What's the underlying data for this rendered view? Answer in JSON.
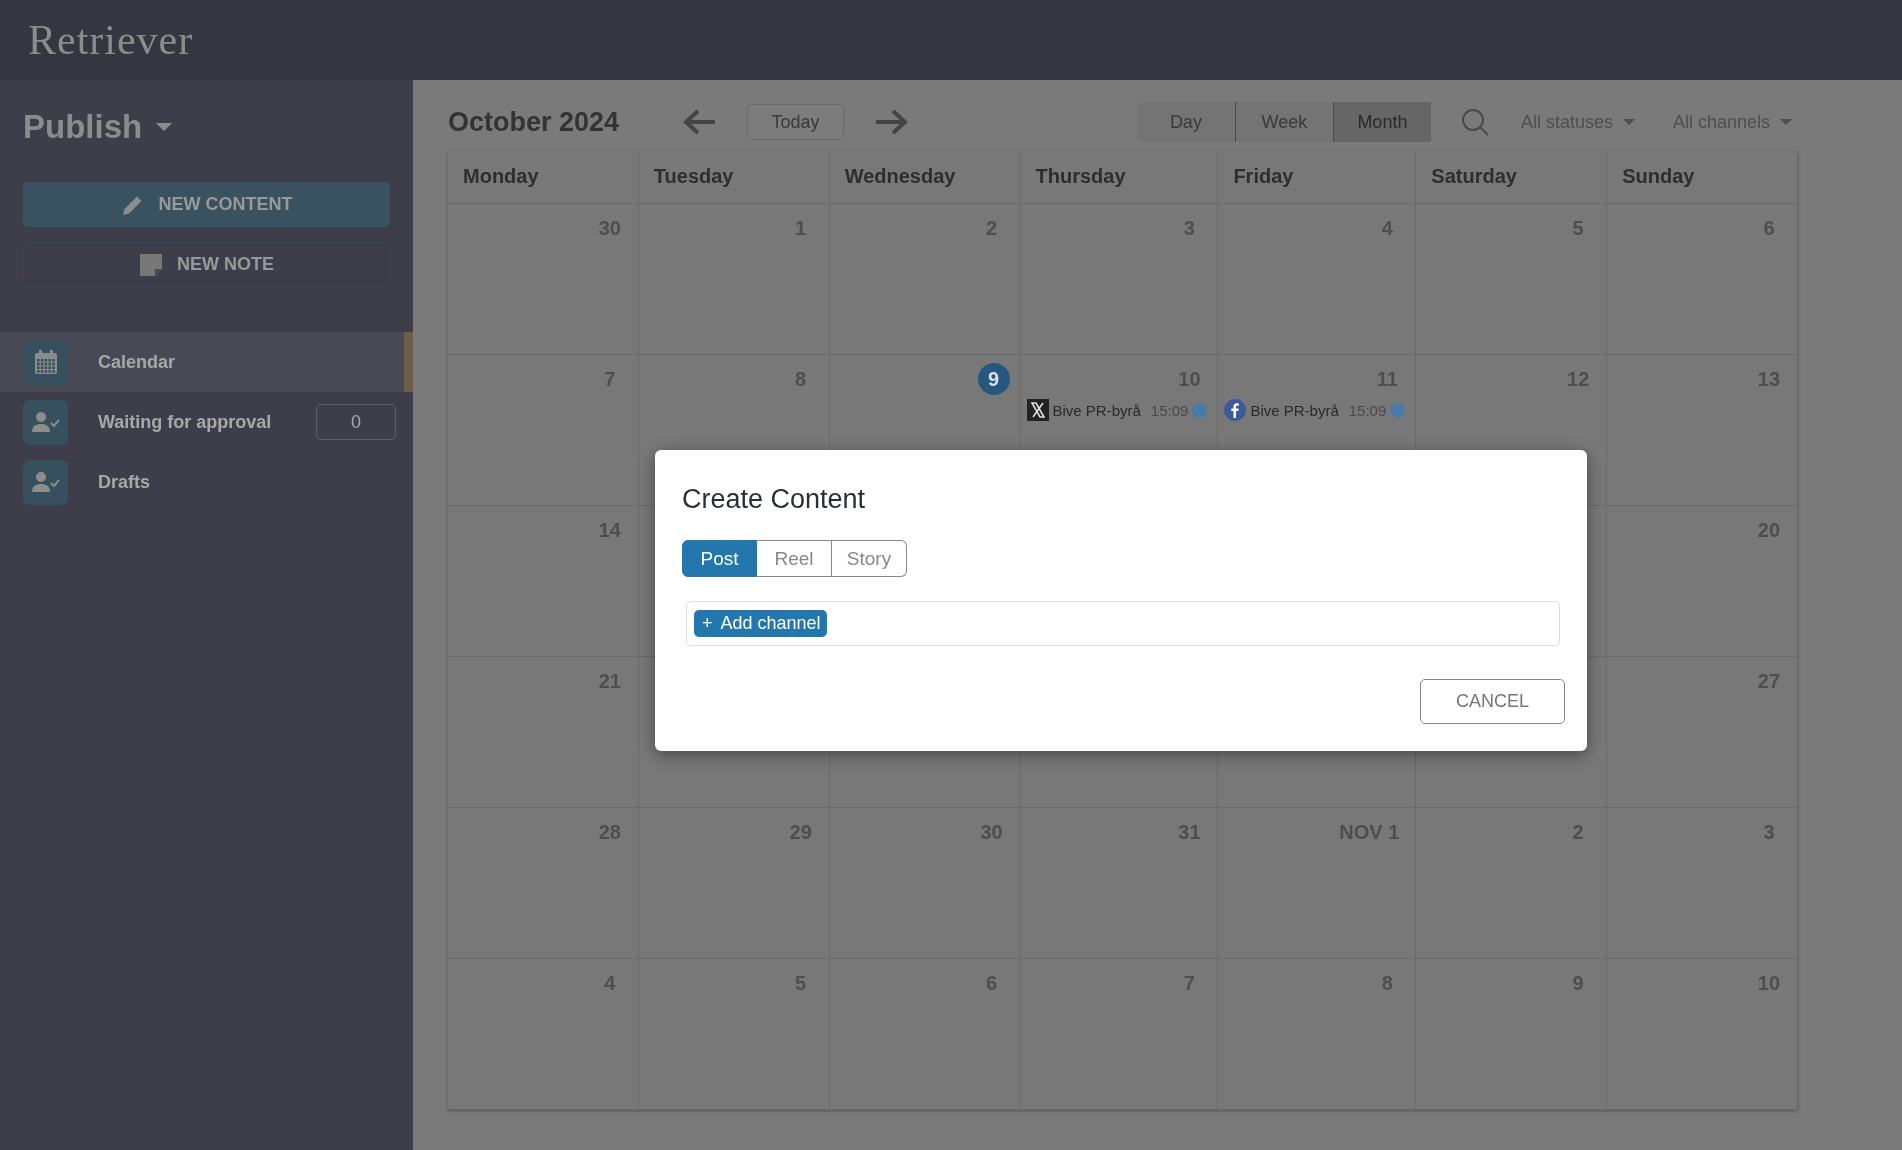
{
  "topbar": {
    "logo": "Retriever"
  },
  "sidebar": {
    "section": "Publish",
    "buttons": [
      {
        "kind": "primary",
        "label": "NEW CONTENT"
      },
      {
        "kind": "outline",
        "label": "NEW NOTE"
      }
    ],
    "items": [
      {
        "label": "Calendar",
        "kind": "calendar",
        "selected": true
      },
      {
        "label": "Waiting for approval",
        "kind": "approval",
        "selected": false,
        "count": "0"
      },
      {
        "label": "Drafts",
        "kind": "approval",
        "selected": false
      }
    ]
  },
  "calendar": {
    "title": "October 2024",
    "today_button": "Today",
    "views": [
      {
        "label": "Day",
        "selected": false
      },
      {
        "label": "Week",
        "selected": false
      },
      {
        "label": "Month",
        "selected": true
      }
    ],
    "filters": [
      "All statuses",
      "All channels"
    ],
    "weekdays": [
      "Monday",
      "Tuesday",
      "Wednesday",
      "Thursday",
      "Friday",
      "Saturday",
      "Sunday"
    ],
    "weeks": [
      {
        "days": [
          {
            "label": "30",
            "today": false
          },
          {
            "label": "1",
            "today": false
          },
          {
            "label": "2",
            "today": false
          },
          {
            "label": "3",
            "today": false
          },
          {
            "label": "4",
            "today": false
          },
          {
            "label": "5",
            "today": false
          },
          {
            "label": "6",
            "today": false
          }
        ]
      },
      {
        "days": [
          {
            "label": "7",
            "today": false
          },
          {
            "label": "8",
            "today": false
          },
          {
            "label": "9",
            "today": true
          },
          {
            "label": "10",
            "today": false,
            "events": [
              {
                "kind": "x",
                "name": "Bive PR-byrå",
                "time": "15:09",
                "color": "#4a7aa8"
              }
            ]
          },
          {
            "label": "11",
            "today": false,
            "events": [
              {
                "kind": "facebook",
                "name": "Bive PR-byrå",
                "time": "15:09",
                "color": "#4a7aa8"
              }
            ]
          },
          {
            "label": "12",
            "today": false
          },
          {
            "label": "13",
            "today": false
          }
        ]
      },
      {
        "days": [
          {
            "label": "14",
            "today": false
          }
        ],
        "end_days": [
          {
            "label": "20",
            "today": false
          }
        ]
      },
      {
        "days": [
          {
            "label": "21",
            "today": false
          }
        ],
        "end_days": [
          {
            "label": "27",
            "today": false
          }
        ]
      },
      {
        "days": [
          {
            "label": "28",
            "today": false
          },
          {
            "label": "29",
            "today": false
          },
          {
            "label": "30",
            "today": false
          },
          {
            "label": "31",
            "today": false
          },
          {
            "label": "NOV 1",
            "today": false
          },
          {
            "label": "2",
            "today": false
          },
          {
            "label": "3",
            "today": false
          }
        ]
      },
      {
        "days": [
          {
            "label": "4",
            "today": false
          },
          {
            "label": "5",
            "today": false
          },
          {
            "label": "6",
            "today": false
          },
          {
            "label": "7",
            "today": false
          },
          {
            "label": "8",
            "today": false
          },
          {
            "label": "9",
            "today": false
          },
          {
            "label": "10",
            "today": false
          }
        ]
      }
    ]
  },
  "dialog": {
    "title": "Create Content",
    "tabs": [
      {
        "label": "Post",
        "selected": true
      },
      {
        "label": "Reel",
        "selected": false
      },
      {
        "label": "Story",
        "selected": false
      }
    ],
    "add_channel": {
      "icon": "+",
      "label": "Add channel"
    },
    "cancel": "CANCEL"
  }
}
